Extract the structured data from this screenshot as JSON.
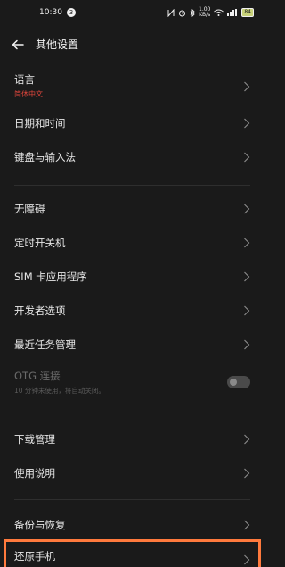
{
  "status": {
    "time": "10:30",
    "notification_badge": "3",
    "icons": [
      "nfc-icon",
      "alarm-icon",
      "bluetooth-icon",
      "speed",
      "wifi-icon",
      "signal-icon"
    ],
    "speed": "1.00\nKB/s",
    "battery": "84"
  },
  "header": {
    "title": "其他设置"
  },
  "items": {
    "language": {
      "label": "语言",
      "sub": "简体中文"
    },
    "datetime": {
      "label": "日期和时间"
    },
    "keyboard": {
      "label": "键盘与输入法"
    },
    "accessibility": {
      "label": "无障碍"
    },
    "scheduled_power": {
      "label": "定时开关机"
    },
    "sim_toolkit": {
      "label": "SIM 卡应用程序"
    },
    "developer": {
      "label": "开发者选项"
    },
    "recent_tasks": {
      "label": "最近任务管理"
    },
    "otg": {
      "label": "OTG 连接",
      "sub": "10 分钟未使用，将自动关闭。",
      "enabled": false
    },
    "downloads": {
      "label": "下载管理"
    },
    "manual": {
      "label": "使用说明"
    },
    "backup": {
      "label": "备份与恢复"
    },
    "reset": {
      "label": "还原手机"
    }
  },
  "colors": {
    "background": "#1a1a1a",
    "accent_sub": "#e0463c",
    "highlight": "#ff7a3d",
    "disabled_text": "#6a6a6a"
  }
}
